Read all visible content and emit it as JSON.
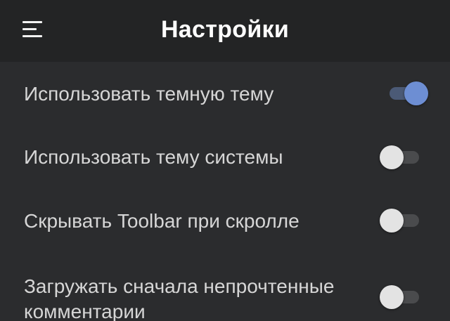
{
  "toolbar": {
    "title": "Настройки",
    "menu_icon": "hamburger-menu-icon"
  },
  "colors": {
    "background": "#2b2c2e",
    "toolbar_background": "#232425",
    "accent": "#6d8ed3",
    "text": "#d6d6d6"
  },
  "settings": [
    {
      "label": "Использовать темную тему",
      "enabled": true
    },
    {
      "label": "Использовать тему системы",
      "enabled": false
    },
    {
      "label": "Скрывать Toolbar при скролле",
      "enabled": false
    },
    {
      "label": "Загружать сначала непрочтенные комментарии",
      "enabled": false
    }
  ]
}
